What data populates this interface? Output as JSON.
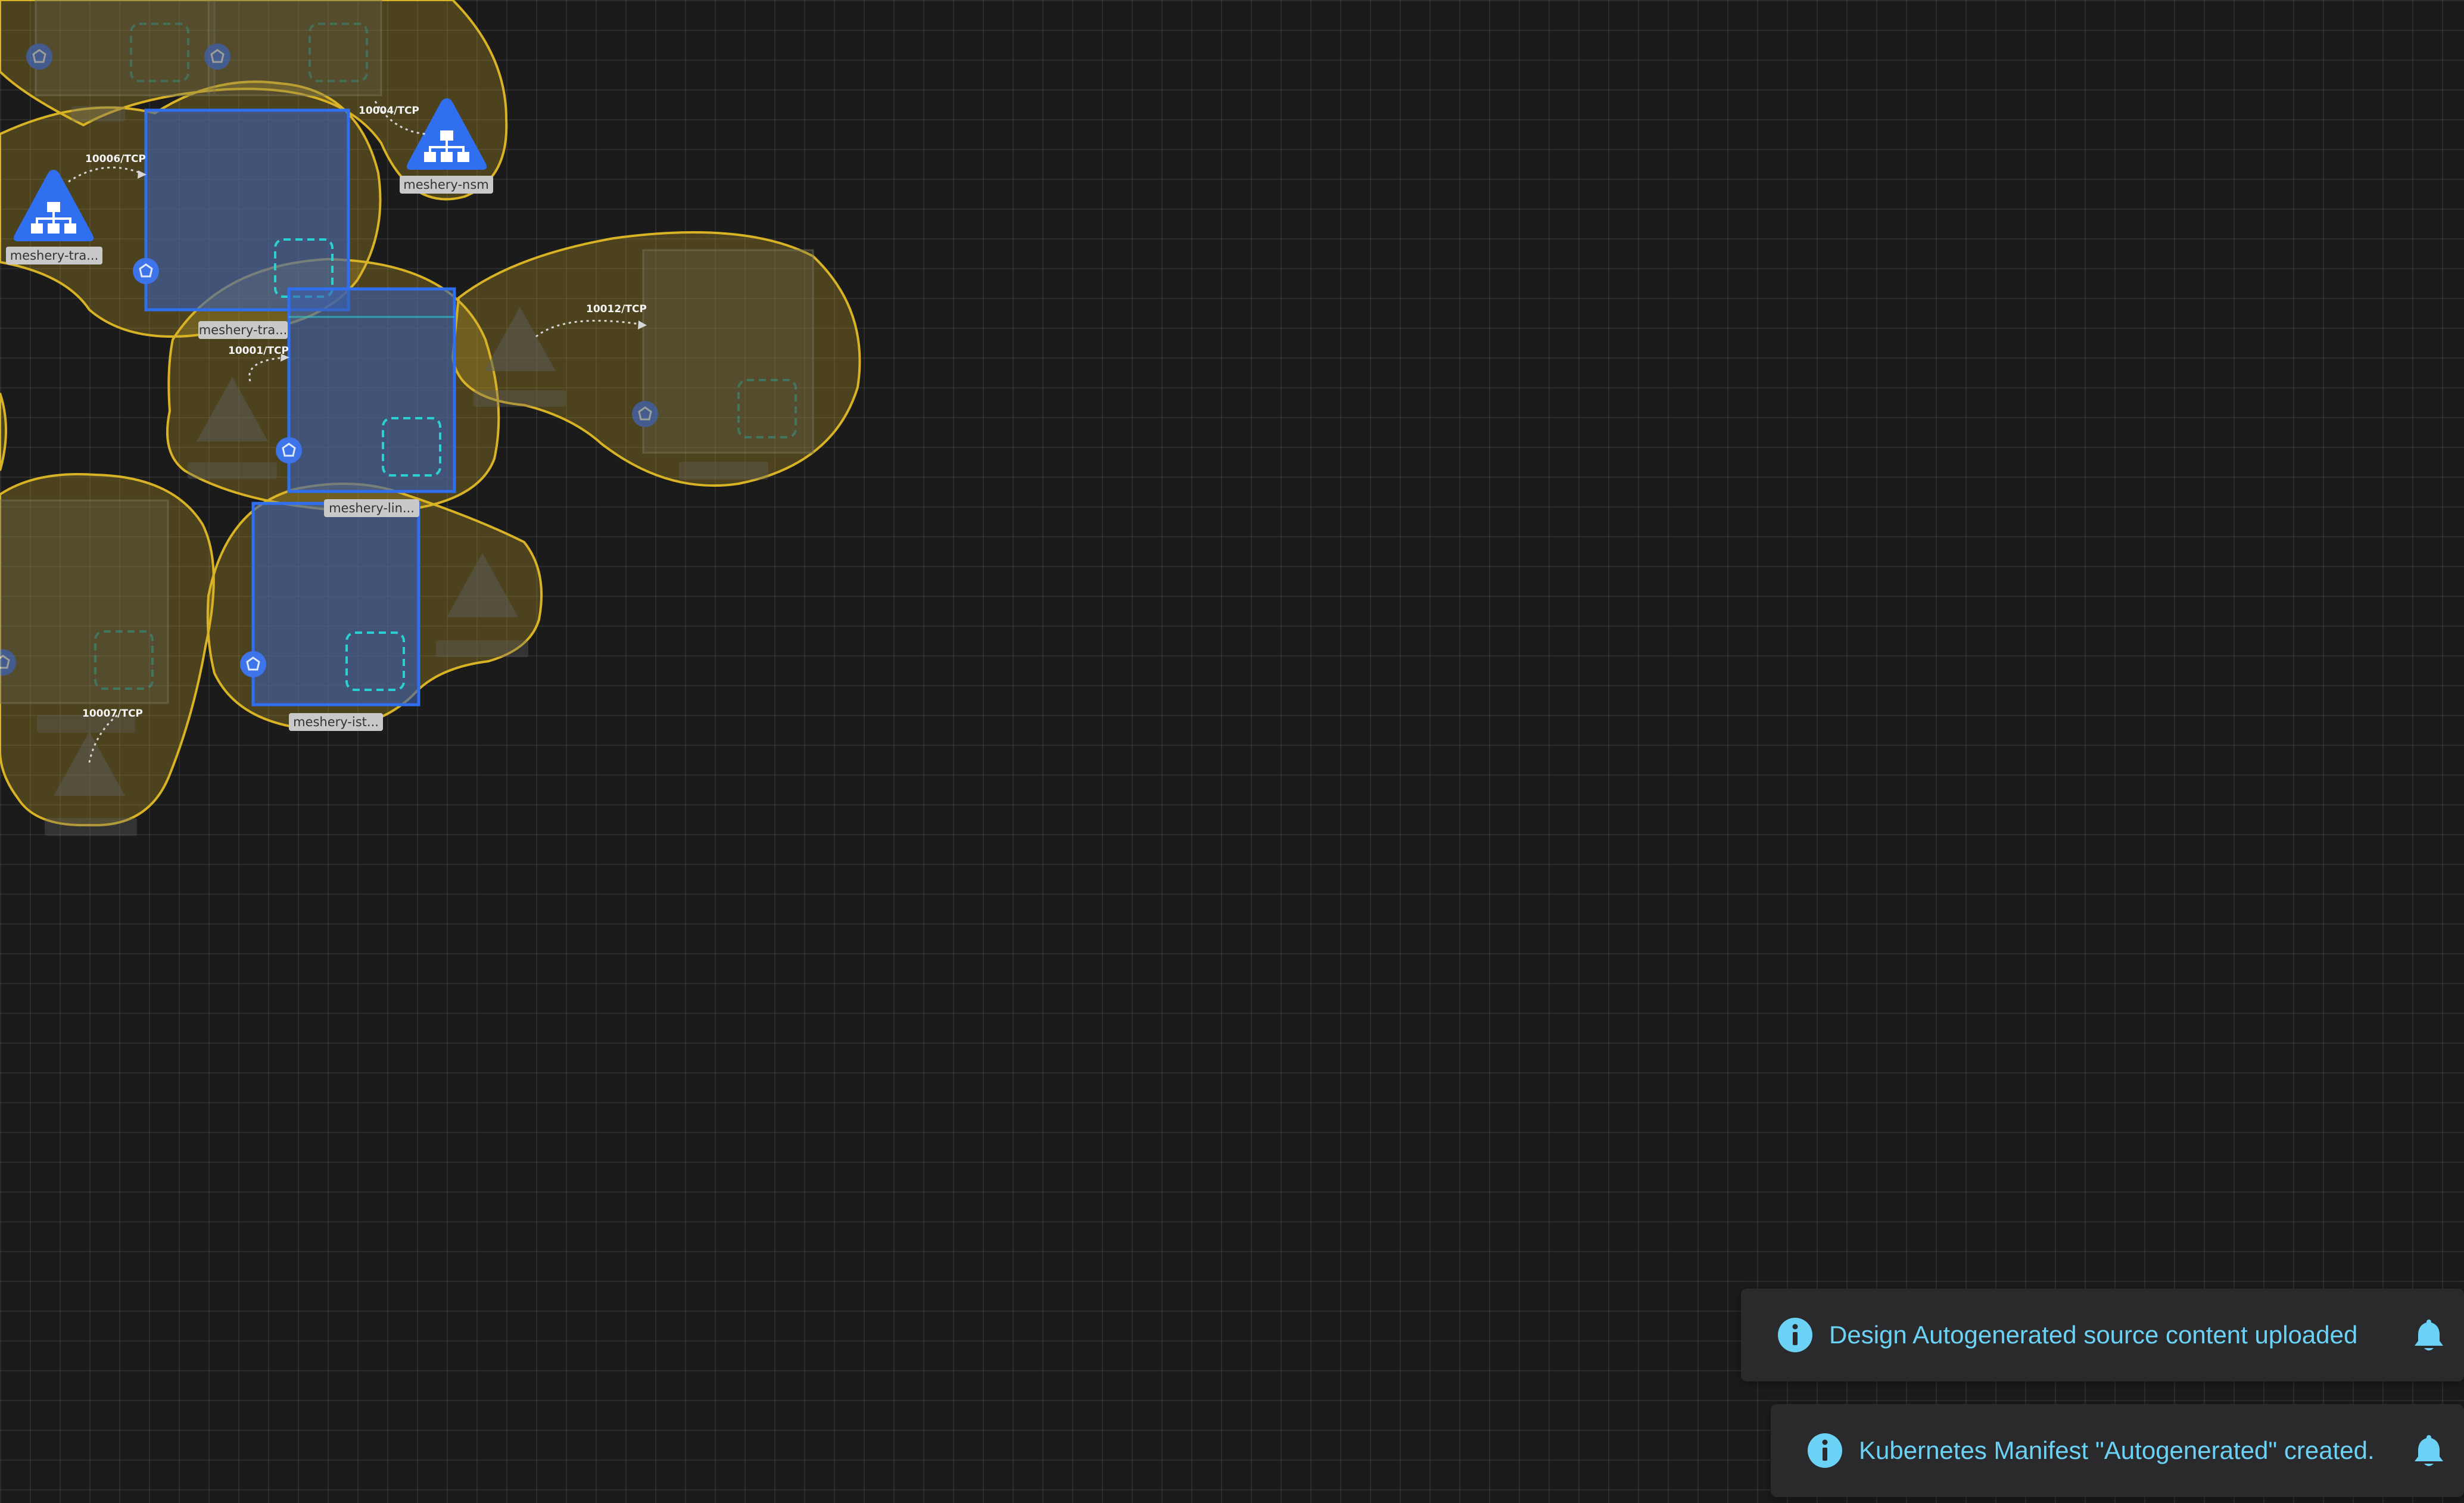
{
  "canvas": {
    "background": "#1b1b1b",
    "accent_yellow": "#d8b326",
    "accent_blue": "#2f6ff0",
    "accent_cyan": "#2bd1d1"
  },
  "nodes": {
    "service_nsm": "meshery-nsm",
    "service_tra": "meshery-tra...",
    "deploy_tra": "meshery-tra...",
    "deploy_lin": "meshery-lin...",
    "deploy_ist": "meshery-ist..."
  },
  "ports": {
    "p1": "10004/TCP",
    "p2": "10006/TCP",
    "p3": "10001/TCP",
    "p4": "10012/TCP",
    "p5": "10007/TCP"
  },
  "notifications": [
    {
      "icon": "info-icon",
      "message": "Design Autogenerated source content uploaded"
    },
    {
      "icon": "info-icon",
      "message": "Kubernetes Manifest \"Autogenerated\" created."
    }
  ]
}
